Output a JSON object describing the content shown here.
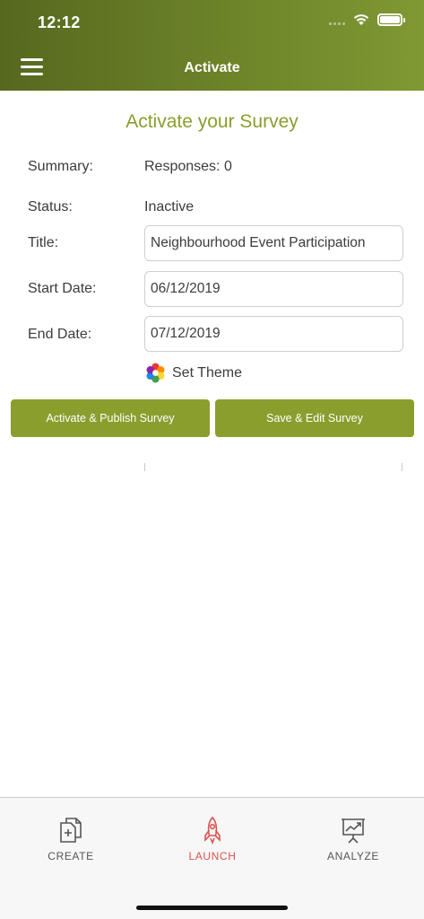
{
  "status_bar": {
    "time": "12:12"
  },
  "header": {
    "title": "Activate"
  },
  "page": {
    "title": "Activate your Survey"
  },
  "form": {
    "summary_label": "Summary:",
    "summary_value": "Responses:  0",
    "status_label": "Status:",
    "status_value": "Inactive",
    "title_label": "Title:",
    "title_value": "Neighbourhood Event Participation",
    "start_label": "Start Date:",
    "start_value": "06/12/2019",
    "end_label": "End Date:",
    "end_value": "07/12/2019",
    "theme_label": "Set Theme"
  },
  "actions": {
    "activate_label": "Activate & Publish Survey",
    "save_label": "Save & Edit Survey"
  },
  "tabs": [
    {
      "label": "CREATE",
      "icon": "create-document-icon",
      "active": false
    },
    {
      "label": "LAUNCH",
      "icon": "rocket-icon",
      "active": true
    },
    {
      "label": "ANALYZE",
      "icon": "analyze-chart-icon",
      "active": false
    }
  ],
  "colors": {
    "header_bg": "#6d8429",
    "accent": "#8a9e2e",
    "active_tab": "#d9534f"
  }
}
